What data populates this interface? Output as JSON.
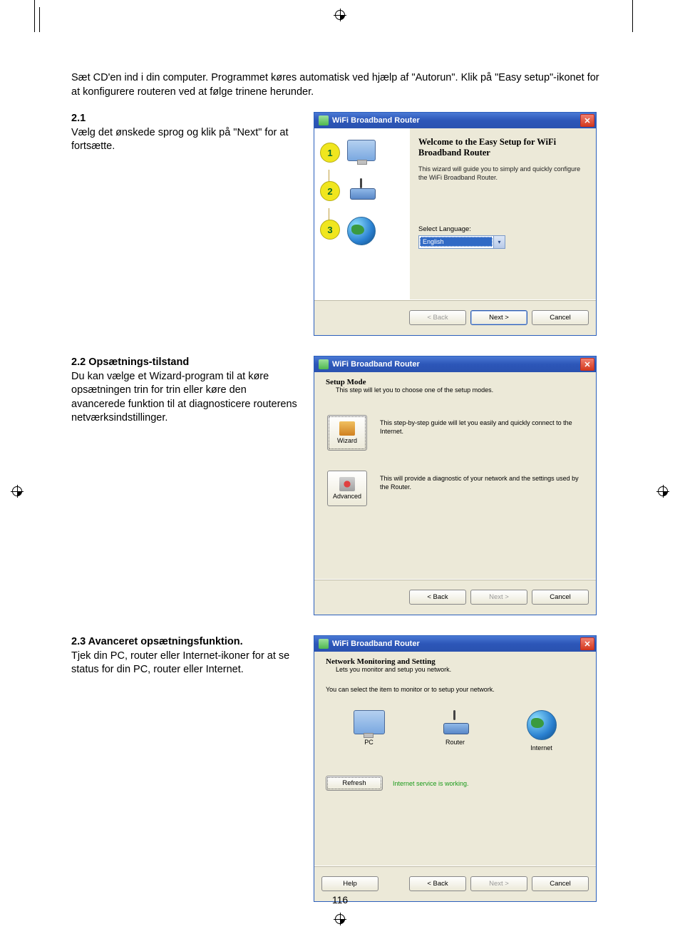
{
  "page_number": "116",
  "intro": "Sæt CD'en ind i din computer. Programmet køres automatisk ved hjælp af \"Autorun\". Klik på \"Easy setup\"-ikonet for at konfigurere routeren ved at følge trinene herunder.",
  "sections": {
    "s1": {
      "num": "2.1",
      "text": "Vælg det ønskede sprog og klik på \"Next\" for at fortsætte."
    },
    "s2": {
      "num": "2.2",
      "title": "Opsætnings-tilstand",
      "text": "Du kan vælge et Wizard-program til at køre opsætningen trin for trin eller køre den avancerede funktion til at diagnosticere routerens netværksindstillinger."
    },
    "s3": {
      "num": "2.3",
      "title": "Avanceret opsætningsfunktion.",
      "text": "Tjek din PC, router eller Internet-ikoner for at se status for din PC, router eller Internet."
    }
  },
  "dialog1": {
    "title": "WiFi Broadband Router",
    "steps": [
      "1",
      "2",
      "3"
    ],
    "welcome": "Welcome to the Easy Setup for WiFi Broadband Router",
    "subtext": "This wizard will guide you to simply and quickly configure the WiFi Broadband Router.",
    "select_label": "Select Language:",
    "language": "English",
    "buttons": {
      "back": "< Back",
      "next": "Next >",
      "cancel": "Cancel"
    }
  },
  "dialog2": {
    "title": "WiFi Broadband Router",
    "heading": "Setup Mode",
    "subline": "This step will let you to choose one of the setup modes.",
    "wizard_label": "Wizard",
    "wizard_desc": "This step-by-step guide will let you easily and quickly connect to the Internet.",
    "advanced_label": "Advanced",
    "advanced_desc": "This will provide a diagnostic of your network and the settings used by the Router.",
    "buttons": {
      "back": "< Back",
      "next": "Next >",
      "cancel": "Cancel"
    }
  },
  "dialog3": {
    "title": "WiFi Broadband Router",
    "heading": "Network Monitoring and Setting",
    "subline": "Lets you monitor and setup you network.",
    "select_text": "You can select the item to monitor or to setup your network.",
    "pc": "PC",
    "router": "Router",
    "internet": "Internet",
    "refresh": "Refresh",
    "status": "Internet service is working.",
    "buttons": {
      "help": "Help",
      "back": "< Back",
      "next": "Next >",
      "cancel": "Cancel"
    }
  }
}
